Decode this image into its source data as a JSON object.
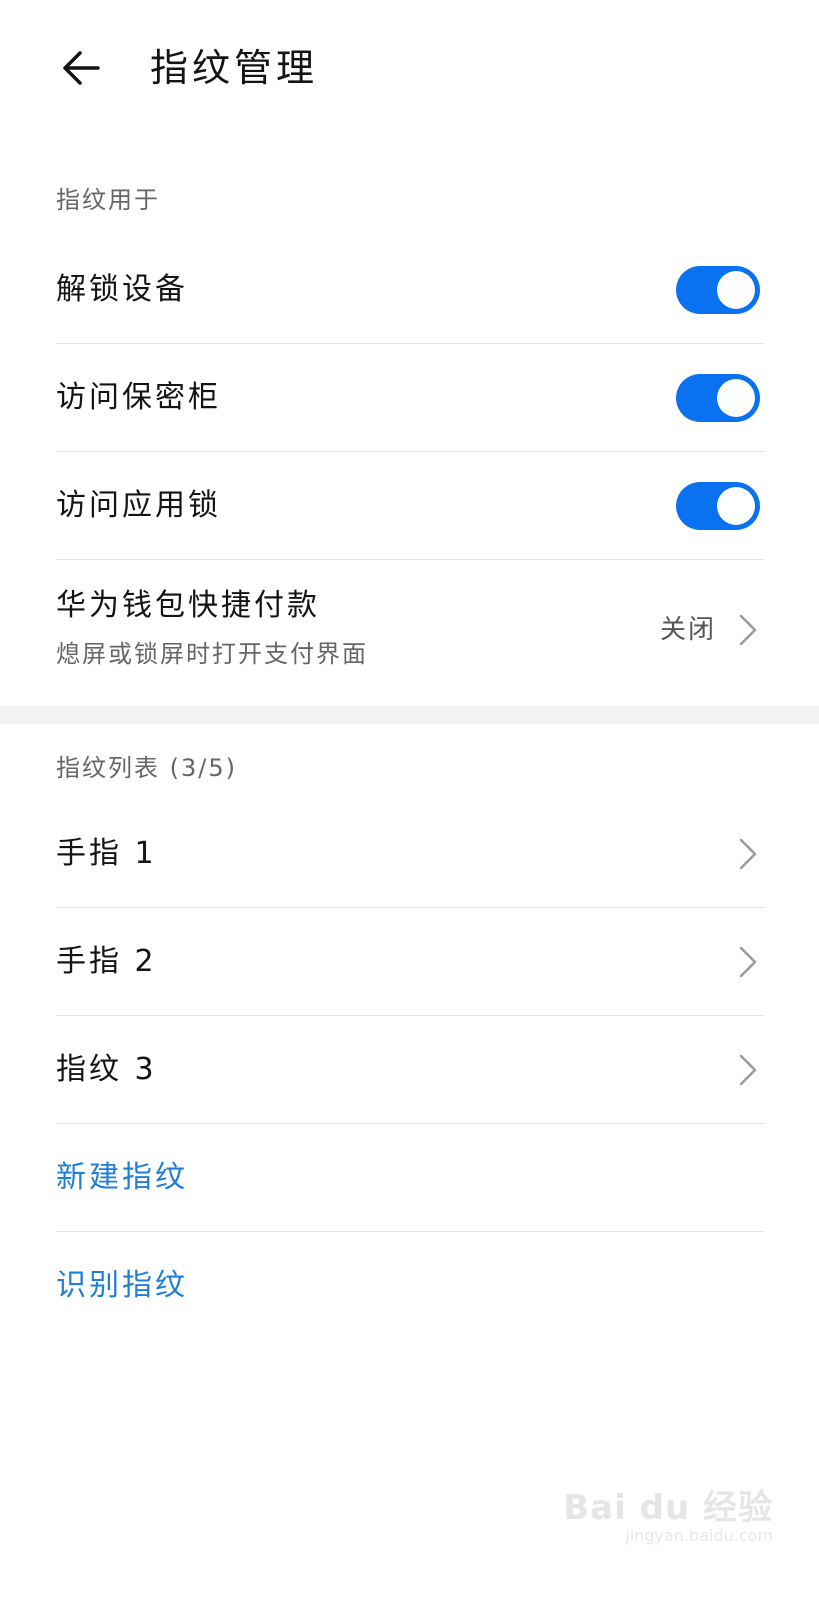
{
  "header": {
    "back_icon": "arrow-left-icon",
    "title": "指纹管理"
  },
  "usage_section": {
    "label": "指纹用于",
    "items": [
      {
        "label": "解锁设备",
        "enabled": true
      },
      {
        "label": "访问保密柜",
        "enabled": true
      },
      {
        "label": "访问应用锁",
        "enabled": true
      }
    ],
    "wallet": {
      "label": "华为钱包快捷付款",
      "subtitle": "熄屏或锁屏时打开支付界面",
      "value": "关闭"
    }
  },
  "list_section": {
    "label": "指纹列表 (3/5)",
    "items": [
      {
        "label": "手指 1"
      },
      {
        "label": "手指 2"
      },
      {
        "label": "指纹 3"
      }
    ],
    "actions": [
      {
        "label": "新建指纹"
      },
      {
        "label": "识别指纹"
      }
    ]
  },
  "watermark": {
    "brand": "Bai du 经验",
    "url": "jingyan.baidu.com"
  },
  "colors": {
    "accent": "#0a72f0",
    "link": "#1f7fd6",
    "divider": "#e5e5e5"
  }
}
